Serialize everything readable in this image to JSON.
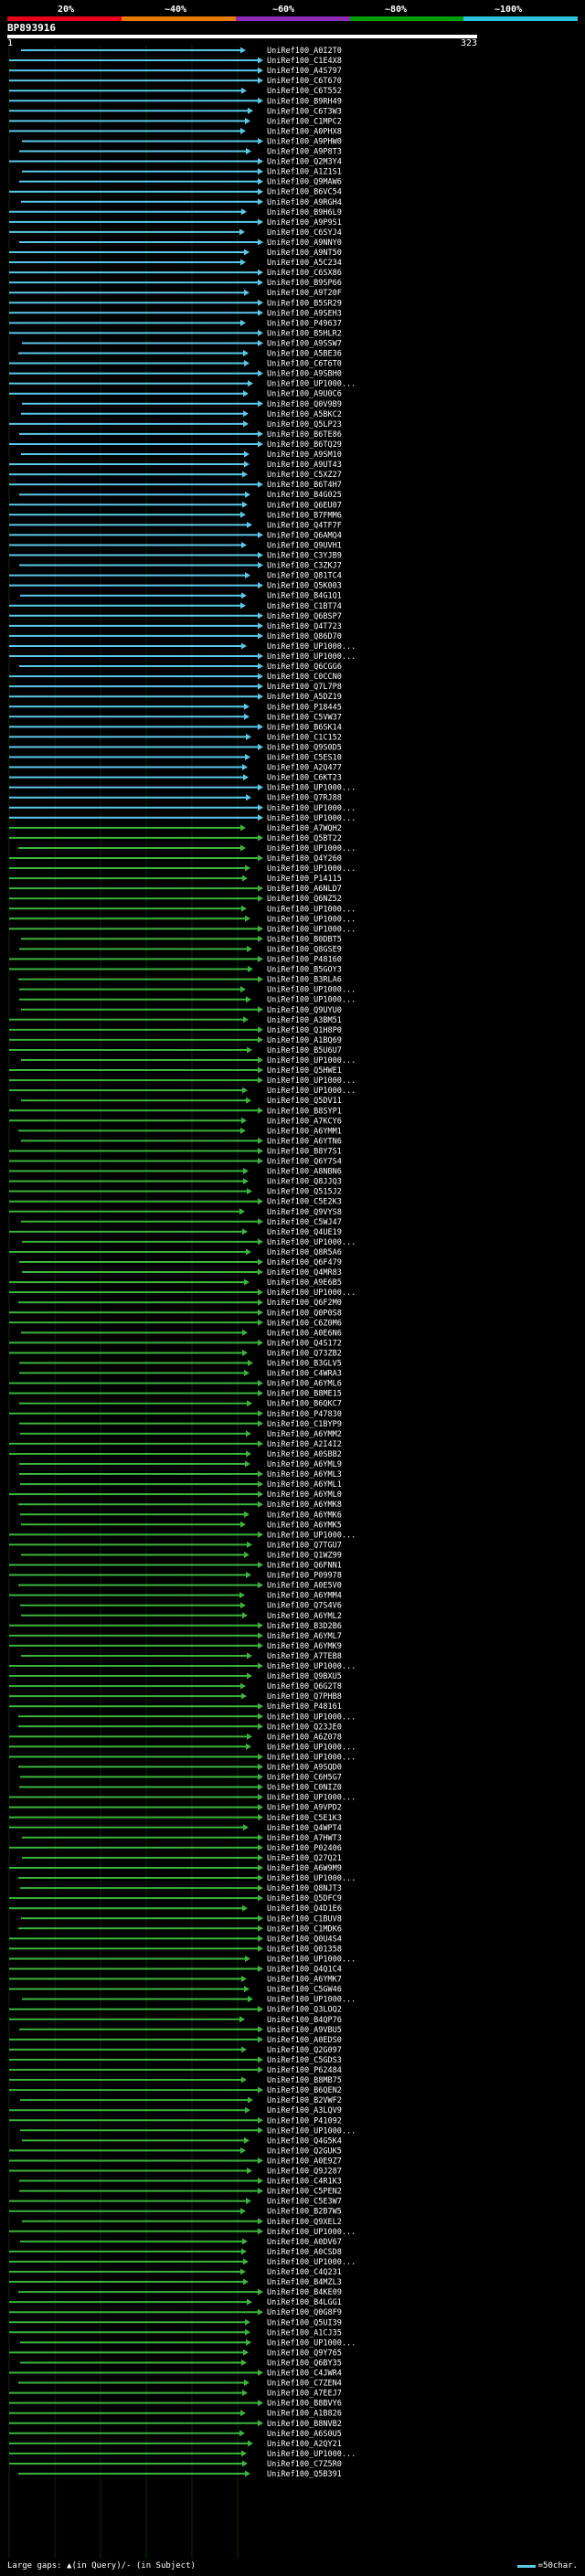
{
  "scale": {
    "labels": [
      "20%",
      "~40%",
      "~60%",
      "~80%",
      "~100%"
    ],
    "colors": [
      "#e8001c",
      "#e87a00",
      "#8e2cb8",
      "#00a000",
      "#2cc4e0"
    ]
  },
  "query": {
    "name": "BP893916",
    "start": "1",
    "end": "323"
  },
  "hits": [
    {
      "label": "UniRef100_A0I2T0",
      "color": "cyan"
    },
    {
      "label": "UniRef100_C1E4X8",
      "color": "cyan"
    },
    {
      "label": "UniRef100_A4S797",
      "color": "cyan"
    },
    {
      "label": "UniRef100_C6T670",
      "color": "cyan"
    },
    {
      "label": "UniRef100_C6T552",
      "color": "cyan"
    },
    {
      "label": "UniRef100_B9RH49",
      "color": "cyan"
    },
    {
      "label": "UniRef100_C6T3W3",
      "color": "cyan"
    },
    {
      "label": "UniRef100_C1MPC2",
      "color": "cyan"
    },
    {
      "label": "UniRef100_A0PHX8",
      "color": "cyan"
    },
    {
      "label": "UniRef100_A9PHW0",
      "color": "cyan"
    },
    {
      "label": "UniRef100_A9P8T3",
      "color": "cyan"
    },
    {
      "label": "UniRef100_Q2M3Y4",
      "color": "cyan"
    },
    {
      "label": "UniRef100_A1Z1S1",
      "color": "cyan"
    },
    {
      "label": "UniRef100_Q9MAW6",
      "color": "cyan"
    },
    {
      "label": "UniRef100_B6VC54",
      "color": "cyan"
    },
    {
      "label": "UniRef100_A9RGH4",
      "color": "cyan"
    },
    {
      "label": "UniRef100_B9H6L9",
      "color": "cyan"
    },
    {
      "label": "UniRef100_A9P9S1",
      "color": "cyan"
    },
    {
      "label": "UniRef100_C6SYJ4",
      "color": "cyan"
    },
    {
      "label": "UniRef100_A9NNY0",
      "color": "cyan"
    },
    {
      "label": "UniRef100_A9NT50",
      "color": "cyan"
    },
    {
      "label": "UniRef100_A5C234",
      "color": "cyan"
    },
    {
      "label": "UniRef100_C6SX86",
      "color": "cyan"
    },
    {
      "label": "UniRef100_B9SP66",
      "color": "cyan"
    },
    {
      "label": "UniRef100_A9T20F",
      "color": "cyan"
    },
    {
      "label": "UniRef100_B5SR29",
      "color": "cyan"
    },
    {
      "label": "UniRef100_A9SEH3",
      "color": "cyan"
    },
    {
      "label": "UniRef100_P49637",
      "color": "cyan"
    },
    {
      "label": "UniRef100_B5HLR2",
      "color": "cyan"
    },
    {
      "label": "UniRef100_A9SSW7",
      "color": "cyan"
    },
    {
      "label": "UniRef100_A5BE36",
      "color": "cyan"
    },
    {
      "label": "UniRef100_C6T6T0",
      "color": "cyan"
    },
    {
      "label": "UniRef100_A9SBH0",
      "color": "cyan"
    },
    {
      "label": "UniRef100_UP1000...",
      "color": "cyan"
    },
    {
      "label": "UniRef100_A9U0C6",
      "color": "cyan"
    },
    {
      "label": "UniRef100_Q0V9B9",
      "color": "cyan"
    },
    {
      "label": "UniRef100_A5BKC2",
      "color": "cyan"
    },
    {
      "label": "UniRef100_Q5LP23",
      "color": "cyan"
    },
    {
      "label": "UniRef100_B6TE86",
      "color": "cyan"
    },
    {
      "label": "UniRef100_B6TQ29",
      "color": "cyan"
    },
    {
      "label": "UniRef100_A9SM10",
      "color": "cyan"
    },
    {
      "label": "UniRef100_A9UT43",
      "color": "cyan"
    },
    {
      "label": "UniRef100_C5XZ27",
      "color": "cyan"
    },
    {
      "label": "UniRef100_B6T4H7",
      "color": "cyan"
    },
    {
      "label": "UniRef100_B4G025",
      "color": "cyan"
    },
    {
      "label": "UniRef100_Q6EU07",
      "color": "cyan"
    },
    {
      "label": "UniRef100_B7FMM6",
      "color": "cyan"
    },
    {
      "label": "UniRef100_Q4TF7F",
      "color": "cyan"
    },
    {
      "label": "UniRef100_Q6AMQ4",
      "color": "cyan"
    },
    {
      "label": "UniRef100_Q9UVH1",
      "color": "cyan"
    },
    {
      "label": "UniRef100_C3YJB9",
      "color": "cyan"
    },
    {
      "label": "UniRef100_C3ZKJ7",
      "color": "cyan"
    },
    {
      "label": "UniRef100_Q81TC4",
      "color": "cyan"
    },
    {
      "label": "UniRef100_Q5K003",
      "color": "cyan"
    },
    {
      "label": "UniRef100_B4G1Q1",
      "color": "cyan"
    },
    {
      "label": "UniRef100_C1BT74",
      "color": "cyan"
    },
    {
      "label": "UniRef100_Q6BSP7",
      "color": "cyan"
    },
    {
      "label": "UniRef100_Q4T723",
      "color": "cyan"
    },
    {
      "label": "UniRef100_Q86D70",
      "color": "cyan"
    },
    {
      "label": "UniRef100_UP1000...",
      "color": "cyan"
    },
    {
      "label": "UniRef100_UP1000...",
      "color": "cyan"
    },
    {
      "label": "UniRef100_Q6CGG6",
      "color": "cyan"
    },
    {
      "label": "UniRef100_C0CCN0",
      "color": "cyan"
    },
    {
      "label": "UniRef100_Q7L7P8",
      "color": "cyan"
    },
    {
      "label": "UniRef100_A5DZ19",
      "color": "cyan"
    },
    {
      "label": "UniRef100_P18445",
      "color": "cyan"
    },
    {
      "label": "UniRef100_C5VW37",
      "color": "cyan"
    },
    {
      "label": "UniRef100_B6SK14",
      "color": "cyan"
    },
    {
      "label": "UniRef100_C1C152",
      "color": "cyan"
    },
    {
      "label": "UniRef100_Q9S0D5",
      "color": "cyan"
    },
    {
      "label": "UniRef100_C5ES10",
      "color": "cyan"
    },
    {
      "label": "UniRef100_A2Q477",
      "color": "cyan"
    },
    {
      "label": "UniRef100_C6KT23",
      "color": "cyan"
    },
    {
      "label": "UniRef100_UP1000...",
      "color": "cyan"
    },
    {
      "label": "UniRef100_Q7RJ88",
      "color": "cyan"
    },
    {
      "label": "UniRef100_UP1000...",
      "color": "cyan"
    },
    {
      "label": "UniRef100_UP1000...",
      "color": "cyan"
    },
    {
      "label": "UniRef100_A7WQH2",
      "color": "green"
    },
    {
      "label": "UniRef100_Q5BT22",
      "color": "green"
    },
    {
      "label": "UniRef100_UP1000...",
      "color": "green"
    },
    {
      "label": "UniRef100_Q4Y260",
      "color": "green"
    },
    {
      "label": "UniRef100_UP1000...",
      "color": "green"
    },
    {
      "label": "UniRef100_P14115",
      "color": "green"
    },
    {
      "label": "UniRef100_A6NLD7",
      "color": "green"
    },
    {
      "label": "UniRef100_Q6NZ52",
      "color": "green"
    },
    {
      "label": "UniRef100_UP1000...",
      "color": "green"
    },
    {
      "label": "UniRef100_UP1000...",
      "color": "green"
    },
    {
      "label": "UniRef100_UP1000...",
      "color": "green"
    },
    {
      "label": "UniRef100_B0DBT5",
      "color": "green"
    },
    {
      "label": "UniRef100_Q8GSE9",
      "color": "green"
    },
    {
      "label": "UniRef100_P48160",
      "color": "green"
    },
    {
      "label": "UniRef100_B5GOY3",
      "color": "green"
    },
    {
      "label": "UniRef100_B3RLA6",
      "color": "green"
    },
    {
      "label": "UniRef100_UP1000...",
      "color": "green"
    },
    {
      "label": "UniRef100_UP1000...",
      "color": "green"
    },
    {
      "label": "UniRef100_Q9UYU0",
      "color": "green"
    },
    {
      "label": "UniRef100_A3BM51",
      "color": "green"
    },
    {
      "label": "UniRef100_Q1H8P0",
      "color": "green"
    },
    {
      "label": "UniRef100_A1BQ69",
      "color": "green"
    },
    {
      "label": "UniRef100_B5U6U7",
      "color": "green"
    },
    {
      "label": "UniRef100_UP1000...",
      "color": "green"
    },
    {
      "label": "UniRef100_Q5HWE1",
      "color": "green"
    },
    {
      "label": "UniRef100_UP1000...",
      "color": "green"
    },
    {
      "label": "UniRef100_UP1000...",
      "color": "green"
    },
    {
      "label": "UniRef100_Q5DV11",
      "color": "green"
    },
    {
      "label": "UniRef100_B8SYP1",
      "color": "green"
    },
    {
      "label": "UniRef100_A7KCY6",
      "color": "green"
    },
    {
      "label": "UniRef100_A6YMM1",
      "color": "green"
    },
    {
      "label": "UniRef100_A6YTN6",
      "color": "green"
    },
    {
      "label": "UniRef100_B8Y7S1",
      "color": "green"
    },
    {
      "label": "UniRef100_Q6Y7S4",
      "color": "green"
    },
    {
      "label": "UniRef100_A8NBN6",
      "color": "green"
    },
    {
      "label": "UniRef100_Q8JJQ3",
      "color": "green"
    },
    {
      "label": "UniRef100_Q515J2",
      "color": "green"
    },
    {
      "label": "UniRef100_C5E2K3",
      "color": "green"
    },
    {
      "label": "UniRef100_Q9VYS8",
      "green": 1,
      "color": "green"
    },
    {
      "label": "UniRef100_C5WJ47",
      "color": "green"
    },
    {
      "label": "UniRef100_Q4UE19",
      "color": "green"
    },
    {
      "label": "UniRef100_UP1000...",
      "color": "green"
    },
    {
      "label": "UniRef100_Q8R5A6",
      "color": "green"
    },
    {
      "label": "UniRef100_Q6F479",
      "color": "green"
    },
    {
      "label": "UniRef100_Q4MR83",
      "color": "green"
    },
    {
      "label": "UniRef100_A9E6B5",
      "color": "green"
    },
    {
      "label": "UniRef100_UP1000...",
      "color": "green"
    },
    {
      "label": "UniRef100_Q6F2M0",
      "color": "green"
    },
    {
      "label": "UniRef100_Q0P0S8",
      "color": "green"
    },
    {
      "label": "UniRef100_C6Z0M6",
      "color": "green"
    },
    {
      "label": "UniRef100_A0E6N6",
      "color": "green"
    },
    {
      "label": "UniRef100_Q4S172",
      "color": "green"
    },
    {
      "label": "UniRef100_Q73ZB2",
      "color": "green"
    },
    {
      "label": "UniRef100_B3GLV5",
      "color": "green"
    },
    {
      "label": "UniRef100_C4WRA3",
      "color": "green"
    },
    {
      "label": "UniRef100_A6YML6",
      "color": "green"
    },
    {
      "label": "UniRef100_B8ME15",
      "color": "green"
    },
    {
      "label": "UniRef100_B6QKC7",
      "color": "green"
    },
    {
      "label": "UniRef100_P47830",
      "color": "green"
    },
    {
      "label": "UniRef100_C1BYP9",
      "color": "green"
    },
    {
      "label": "UniRef100_A6YMM2",
      "color": "green"
    },
    {
      "label": "UniRef100_A2I4I2",
      "color": "green"
    },
    {
      "label": "UniRef100_A0SBB2",
      "color": "green"
    },
    {
      "label": "UniRef100_A6YML9",
      "color": "green"
    },
    {
      "label": "UniRef100_A6YML3",
      "color": "green"
    },
    {
      "label": "UniRef100_A6YML1",
      "color": "green"
    },
    {
      "label": "UniRef100_A6YML0",
      "color": "green"
    },
    {
      "label": "UniRef100_A6YMK8",
      "color": "green"
    },
    {
      "label": "UniRef100_A6YMK6",
      "color": "green"
    },
    {
      "label": "UniRef100_A6YMK5",
      "color": "green"
    },
    {
      "label": "UniRef100_UP1000...",
      "color": "green"
    },
    {
      "label": "UniRef100_Q7TGU7",
      "color": "green"
    },
    {
      "label": "UniRef100_Q1WZ99",
      "color": "green"
    },
    {
      "label": "UniRef100_Q6FNN1",
      "color": "green"
    },
    {
      "label": "UniRef100_P09978",
      "color": "green"
    },
    {
      "label": "UniRef100_A0E5V0",
      "color": "green"
    },
    {
      "label": "UniRef100_A6YMM4",
      "color": "green"
    },
    {
      "label": "UniRef100_Q7S4V6",
      "color": "green"
    },
    {
      "label": "UniRef100_A6YML2",
      "color": "green"
    },
    {
      "label": "UniRef100_B3D2B6",
      "color": "green"
    },
    {
      "label": "UniRef100_A6YML7",
      "color": "green"
    },
    {
      "label": "UniRef100_A6YMK9",
      "color": "green"
    },
    {
      "label": "UniRef100_A7TEB8",
      "color": "green"
    },
    {
      "label": "UniRef100_UP1000...",
      "color": "green"
    },
    {
      "label": "UniRef100_Q9BXU5",
      "color": "green"
    },
    {
      "label": "UniRef100_Q6G2T8",
      "color": "green"
    },
    {
      "label": "UniRef100_Q7PHB8",
      "color": "green"
    },
    {
      "label": "UniRef100_P48161",
      "color": "green"
    },
    {
      "label": "UniRef100_UP1000...",
      "color": "green"
    },
    {
      "label": "UniRef100_Q23JE0",
      "color": "green"
    },
    {
      "label": "UniRef100_A6Z078",
      "color": "green"
    },
    {
      "label": "UniRef100_UP1000...",
      "color": "green"
    },
    {
      "label": "UniRef100_UP1000...",
      "color": "green"
    },
    {
      "label": "UniRef100_A9SQD0",
      "color": "green"
    },
    {
      "label": "UniRef100_C6H5G7",
      "color": "green"
    },
    {
      "label": "UniRef100_C0NIZ0",
      "color": "green"
    },
    {
      "label": "UniRef100_UP1000...",
      "color": "green"
    },
    {
      "label": "UniRef100_A9VPD2",
      "color": "green"
    },
    {
      "label": "UniRef100_C5E1K3",
      "color": "green"
    },
    {
      "label": "UniRef100_Q4WPT4",
      "color": "green"
    },
    {
      "label": "UniRef100_A7HWT3",
      "color": "green"
    },
    {
      "label": "UniRef100_P02406",
      "color": "green"
    },
    {
      "label": "UniRef100_Q27Q21",
      "color": "green"
    },
    {
      "label": "UniRef100_A6W9M9",
      "color": "green"
    },
    {
      "label": "UniRef100_UP1000...",
      "color": "green"
    },
    {
      "label": "UniRef100_Q8NJT3",
      "color": "green"
    },
    {
      "label": "UniRef100_Q5DFC9",
      "color": "green"
    },
    {
      "label": "UniRef100_Q4D1E6",
      "color": "green"
    },
    {
      "label": "UniRef100_C1BUV8",
      "color": "green"
    },
    {
      "label": "UniRef100_C1MDK6",
      "color": "green"
    },
    {
      "label": "UniRef100_Q0U4S4",
      "color": "green"
    },
    {
      "label": "UniRef100_Q01358",
      "color": "green"
    },
    {
      "label": "UniRef100_UP1000...",
      "color": "green"
    },
    {
      "label": "UniRef100_Q4Q1C4",
      "color": "green"
    },
    {
      "label": "UniRef100_A6YMK7",
      "color": "green"
    },
    {
      "label": "UniRef100_C5GW46",
      "color": "green"
    },
    {
      "label": "UniRef100_UP1000...",
      "color": "green"
    },
    {
      "label": "UniRef100_Q3LOQ2",
      "color": "green"
    },
    {
      "label": "UniRef100_B4QP76",
      "color": "green"
    },
    {
      "label": "UniRef100_A9VBU5",
      "color": "green"
    },
    {
      "label": "UniRef100_A0EDS0",
      "color": "green"
    },
    {
      "label": "UniRef100_Q2G097",
      "color": "green"
    },
    {
      "label": "UniRef100_C5GDS3",
      "color": "green"
    },
    {
      "label": "UniRef100_P62484",
      "color": "green"
    },
    {
      "label": "UniRef100_B8MB75",
      "color": "green"
    },
    {
      "label": "UniRef100_B6QEN2",
      "color": "green"
    },
    {
      "label": "UniRef100_B2VWF2",
      "color": "green"
    },
    {
      "label": "UniRef100_A3LQV9",
      "color": "green"
    },
    {
      "label": "UniRef100_P41092",
      "color": "green"
    },
    {
      "label": "UniRef100_UP1000...",
      "color": "green"
    },
    {
      "label": "UniRef100_Q4G5K4",
      "color": "green"
    },
    {
      "label": "UniRef100_Q2GUK5",
      "color": "green"
    },
    {
      "label": "UniRef100_A0E9Z7",
      "color": "green"
    },
    {
      "label": "UniRef100_Q9J287",
      "color": "green"
    },
    {
      "label": "UniRef100_C4R1K3",
      "color": "green"
    },
    {
      "label": "UniRef100_C5PEN2",
      "color": "green"
    },
    {
      "label": "UniRef100_C5E3W7",
      "color": "green"
    },
    {
      "label": "UniRef100_B2B7W5",
      "color": "green"
    },
    {
      "label": "UniRef100_Q9XEL2",
      "color": "green"
    },
    {
      "label": "UniRef100_UP1000...",
      "color": "green"
    },
    {
      "label": "UniRef100_A0DV67",
      "color": "green"
    },
    {
      "label": "UniRef100_A0CSD8",
      "color": "green"
    },
    {
      "label": "UniRef100_UP1000...",
      "color": "green"
    },
    {
      "label": "UniRef100_C4Q231",
      "color": "green"
    },
    {
      "label": "UniRef100_B4MZL3",
      "color": "green"
    },
    {
      "label": "UniRef100_B4KE09",
      "color": "green"
    },
    {
      "label": "UniRef100_B4LGG1",
      "color": "green"
    },
    {
      "label": "UniRef100_Q0G8F9",
      "color": "green"
    },
    {
      "label": "UniRef100_Q5UI39",
      "color": "green"
    },
    {
      "label": "UniRef100_A1CJ35",
      "color": "green"
    },
    {
      "label": "UniRef100_UP1000...",
      "color": "green"
    },
    {
      "label": "UniRef100_Q9Y765",
      "color": "green"
    },
    {
      "label": "UniRef100_Q6BY35",
      "color": "green"
    },
    {
      "label": "UniRef100_C4JWR4",
      "color": "green"
    },
    {
      "label": "UniRef100_C7ZEN4",
      "color": "green"
    },
    {
      "label": "UniRef100_A7EEJ7",
      "color": "green"
    },
    {
      "label": "UniRef100_B8BVY6",
      "color": "green"
    },
    {
      "label": "UniRef100_A1B826",
      "color": "green"
    },
    {
      "label": "UniRef100_B8NVB2",
      "color": "green"
    },
    {
      "label": "UniRef100_A6S0U5",
      "color": "green"
    },
    {
      "label": "UniRef100_A2QY21",
      "color": "green"
    },
    {
      "label": "UniRef100_UP1000...",
      "color": "green"
    },
    {
      "label": "UniRef100_C7Z5R0",
      "color": "green"
    },
    {
      "label": "UniRef100_Q5B391",
      "color": "green"
    }
  ],
  "footer": {
    "gaps_text": "Large gaps: ▲(in Query)/- (in Subject)",
    "legend_text": "=50char."
  }
}
